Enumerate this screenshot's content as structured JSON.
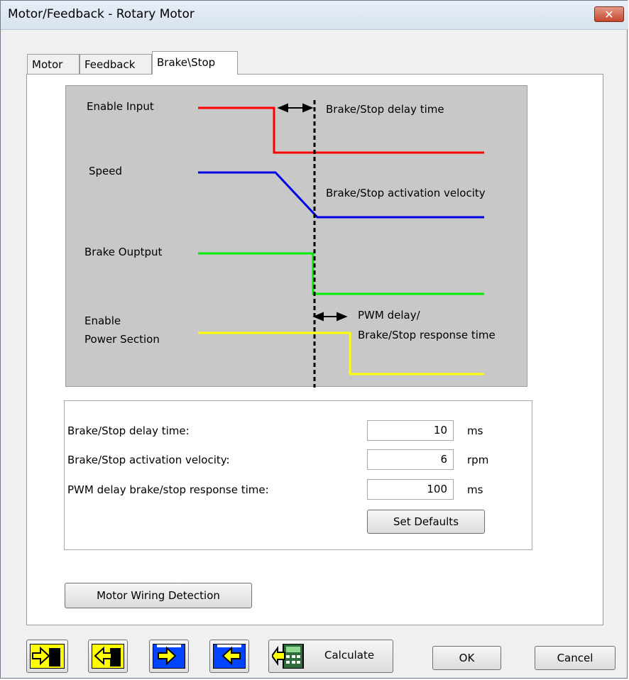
{
  "window": {
    "title": "Motor/Feedback - Rotary Motor",
    "close_label": "✕"
  },
  "tabs": [
    {
      "label": "Motor"
    },
    {
      "label": "Feedback"
    },
    {
      "label": "Brake\\Stop"
    }
  ],
  "diagram": {
    "labels": {
      "enable_input": "Enable Input",
      "speed": "Speed",
      "brake_output": "Brake Ouptput",
      "enable_power_1": "Enable",
      "enable_power_2": "Power Section",
      "delay_time": "Brake/Stop delay time",
      "activation_velocity": "Brake/Stop activation velocity",
      "pwm_delay_1": "PWM delay/",
      "pwm_delay_2": "Brake/Stop response time"
    },
    "colors": {
      "enable": "#ff0000",
      "speed": "#0000e6",
      "brake": "#00ee00",
      "power": "#ffff00",
      "background": "#c8c8c8"
    }
  },
  "params": {
    "delay_label": "Brake/Stop delay time:",
    "delay_value": "10",
    "delay_unit": "ms",
    "velocity_label": "Brake/Stop activation velocity:",
    "velocity_value": "6",
    "velocity_unit": "rpm",
    "pwm_label": "PWM delay brake/stop response time:",
    "pwm_value": "100",
    "pwm_unit": "ms",
    "defaults_button": "Set Defaults"
  },
  "motor_wiring_button": "Motor Wiring Detection",
  "toolbar": {
    "calculate_label": "Calculate",
    "ok_label": "OK",
    "cancel_label": "Cancel",
    "icons": [
      "import-icon",
      "export-icon",
      "upload-to-drive-icon",
      "download-from-drive-icon",
      "calculator-icon"
    ]
  }
}
